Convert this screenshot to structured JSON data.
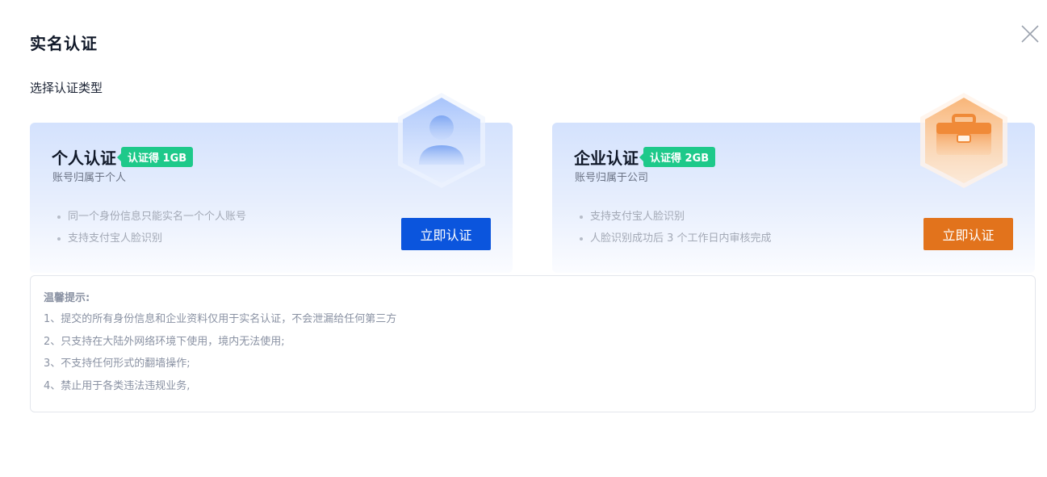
{
  "dialog": {
    "title": "实名认证",
    "subtitle": "选择认证类型",
    "close_icon": "close-icon"
  },
  "cards": {
    "personal": {
      "title": "个人认证",
      "badge": "认证得 1GB",
      "description": "账号归属于个人",
      "features": [
        "同一个身份信息只能实名一个个人账号",
        "支持支付宝人脸识别"
      ],
      "button_label": "立即认证",
      "button_color": "#0b55dd",
      "icon": "person-icon"
    },
    "enterprise": {
      "title": "企业认证",
      "badge": "认证得 2GB",
      "description": "账号归属于公司",
      "features": [
        "支持支付宝人脸识别",
        "人脸识别成功后 3 个工作日内审核完成"
      ],
      "button_label": "立即认证",
      "button_color": "#e2731c",
      "icon": "briefcase-icon"
    }
  },
  "tips": {
    "title": "温馨提示:",
    "items": [
      "1、提交的所有身份信息和企业资料仅用于实名认证，不会泄漏给任何第三方",
      "2、只支持在大陆外网络环境下使用，境内无法使用;",
      "3、不支持任何形式的翻墙操作;",
      "4、禁止用于各类违法违规业务,"
    ]
  },
  "colors": {
    "badge": "#1ec98a",
    "card_gradient_top": "#d4e2fd"
  }
}
